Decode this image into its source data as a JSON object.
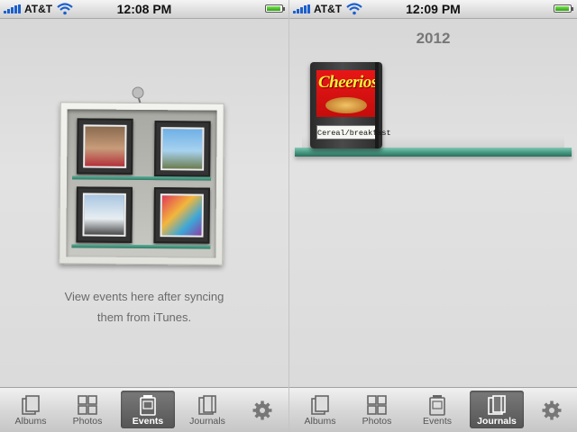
{
  "status_left": {
    "carrier": "AT&T",
    "time": "12:08 PM"
  },
  "status_right": {
    "carrier": "AT&T",
    "time": "12:09 PM"
  },
  "left_screen": {
    "empty_message_line1": "View events here after syncing",
    "empty_message_line2": "them from iTunes."
  },
  "right_screen": {
    "year": "2012",
    "journal": {
      "cover_brand": "Cheerios",
      "label": "Cereal/breakfast"
    }
  },
  "tabs_left": [
    {
      "label": "Albums",
      "icon": "albums-icon"
    },
    {
      "label": "Photos",
      "icon": "photos-icon"
    },
    {
      "label": "Events",
      "icon": "events-icon",
      "selected": true
    },
    {
      "label": "Journals",
      "icon": "journals-icon"
    },
    {
      "label": "",
      "icon": "gear-icon"
    }
  ],
  "tabs_right": [
    {
      "label": "Albums",
      "icon": "albums-icon"
    },
    {
      "label": "Photos",
      "icon": "photos-icon"
    },
    {
      "label": "Events",
      "icon": "events-icon"
    },
    {
      "label": "Journals",
      "icon": "journals-icon",
      "selected": true
    },
    {
      "label": "",
      "icon": "gear-icon"
    }
  ],
  "colors": {
    "shelf": "#4a9c85",
    "signal": "#1b5fce",
    "battery": "#3fb318",
    "selected_tab": "#666666"
  }
}
